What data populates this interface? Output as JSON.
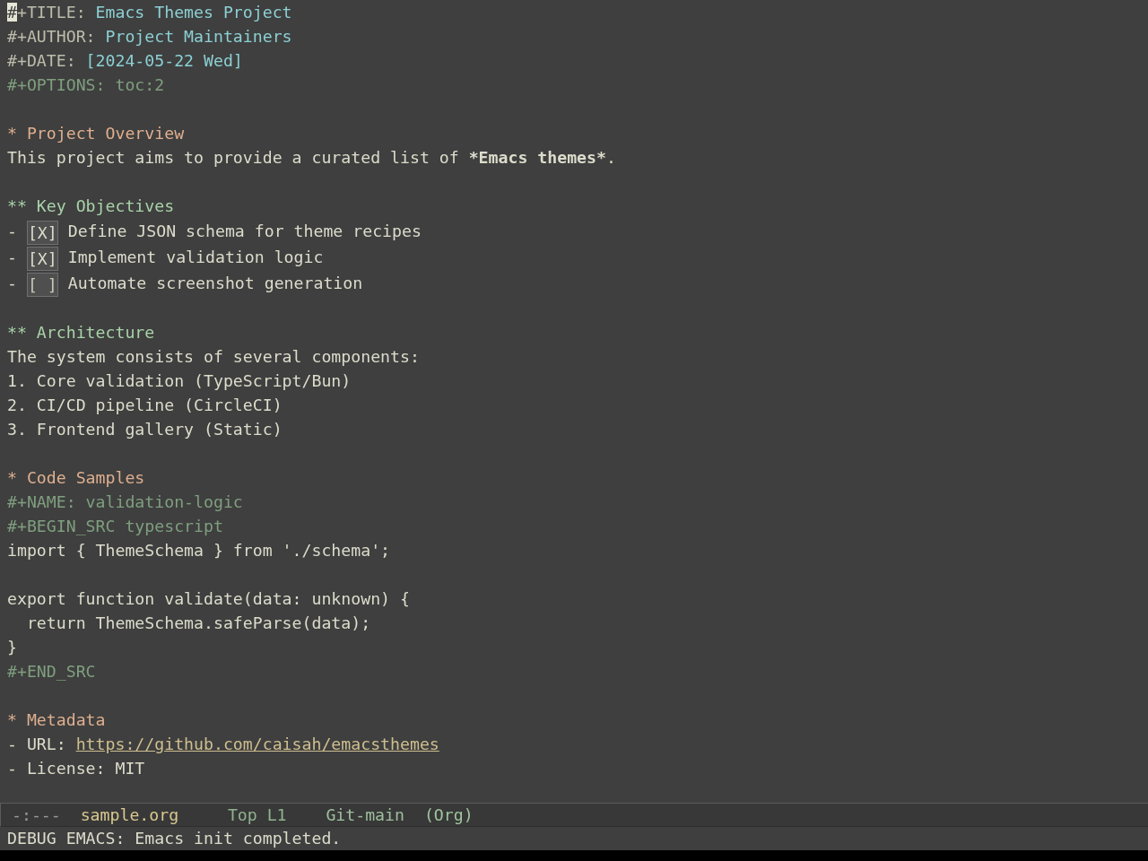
{
  "header": [
    {
      "kind": "keyword",
      "key": "#+TITLE:",
      "value": "Emacs Themes Project",
      "cursor": true
    },
    {
      "kind": "keyword",
      "key": "#+AUTHOR:",
      "value": "Project Maintainers",
      "cursor": false
    },
    {
      "kind": "keyword",
      "key": "#+DATE:",
      "value": "[2024-05-22 Wed]",
      "cursor": false
    },
    {
      "kind": "option",
      "key": "#+OPTIONS:",
      "value": "toc:2",
      "cursor": false
    }
  ],
  "outline": [
    {
      "marker": "*",
      "title": "Project Overview",
      "body": [
        {
          "kind": "paragraph",
          "segments": [
            {
              "text": "This project aims to provide a curated list of ",
              "bold": false
            },
            {
              "text": "*Emacs themes*",
              "bold": true
            },
            {
              "text": ".",
              "bold": false
            }
          ]
        }
      ],
      "children": [
        {
          "marker": "**",
          "title": "Key Objectives",
          "body": [
            {
              "kind": "checkbox",
              "bullet": "-",
              "box": "[X]",
              "checked": true,
              "label": "Define JSON schema for theme recipes"
            },
            {
              "kind": "checkbox",
              "bullet": "-",
              "box": "[X]",
              "checked": true,
              "label": "Implement validation logic"
            },
            {
              "kind": "checkbox",
              "bullet": "-",
              "box": "[ ]",
              "checked": false,
              "label": "Automate screenshot generation"
            }
          ]
        },
        {
          "marker": "**",
          "title": "Architecture",
          "body": [
            {
              "kind": "text",
              "text": "The system consists of several components:"
            },
            {
              "kind": "numbered",
              "number": "1.",
              "label": "Core validation (TypeScript/Bun)"
            },
            {
              "kind": "numbered",
              "number": "2.",
              "label": "CI/CD pipeline (CircleCI)"
            },
            {
              "kind": "numbered",
              "number": "3.",
              "label": "Frontend gallery (Static)"
            }
          ]
        }
      ]
    },
    {
      "marker": "*",
      "title": "Code Samples",
      "body": [
        {
          "kind": "src_block",
          "name_line": "#+NAME: validation-logic",
          "begin_line": "#+BEGIN_SRC typescript",
          "code": "import { ThemeSchema } from './schema';\n\nexport function validate(data: unknown) {\n  return ThemeSchema.safeParse(data);\n}",
          "end_line": "#+END_SRC"
        }
      ]
    },
    {
      "marker": "*",
      "title": "Metadata",
      "body": [
        {
          "kind": "link_item",
          "text": "- URL:",
          "link": "https://github.com/caisah/emacsthemes"
        },
        {
          "kind": "text",
          "text": "- License: MIT"
        }
      ]
    }
  ],
  "mode_line": {
    "segments": [
      {
        "kind": "status",
        "text": "-:---"
      },
      {
        "kind": "buffer",
        "text": "sample.org"
      },
      {
        "kind": "position",
        "text": "Top L1"
      },
      {
        "kind": "vc",
        "text": "Git-main"
      },
      {
        "kind": "mode",
        "text": "(Org)"
      }
    ]
  },
  "echo_area": {
    "message": "DEBUG EMACS: Emacs init completed."
  }
}
